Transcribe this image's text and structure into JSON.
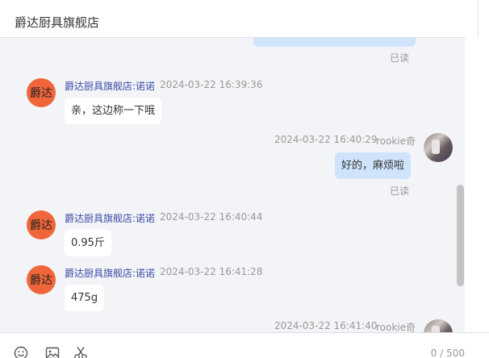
{
  "header": {
    "title": "爵达厨具旗舰店"
  },
  "shop": {
    "avatar_text": "爵达"
  },
  "messages": [
    {
      "kind": "read",
      "status": "已读"
    },
    {
      "kind": "shop",
      "sender": "爵达厨具旗舰店:诺诺",
      "time": "2024-03-22 16:39:36",
      "text": "亲，这边称一下哦"
    },
    {
      "kind": "me",
      "time": "2024-03-22 16:40:29",
      "user": "rookie奇",
      "text": "好的，麻烦啦",
      "status": "已读"
    },
    {
      "kind": "shop",
      "sender": "爵达厨具旗舰店:诺诺",
      "time": "2024-03-22 16:40:44",
      "text": "0.95斤"
    },
    {
      "kind": "shop",
      "sender": "爵达厨具旗舰店:诺诺",
      "time": "2024-03-22 16:41:28",
      "text": "475g"
    },
    {
      "kind": "me-partial",
      "time": "2024-03-22 16:41:40",
      "user": "rookie奇"
    }
  ],
  "input": {
    "counter": "0 / 500"
  },
  "icons": [
    "emoji-icon",
    "image-icon",
    "scissors-icon"
  ]
}
